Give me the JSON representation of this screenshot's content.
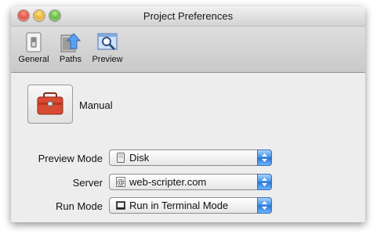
{
  "window": {
    "title": "Project Preferences"
  },
  "toolbar": {
    "items": [
      {
        "label": "General",
        "icon": "general-switch-icon"
      },
      {
        "label": "Paths",
        "icon": "paths-folder-arrow-icon"
      },
      {
        "label": "Preview",
        "icon": "preview-magnifier-icon"
      }
    ]
  },
  "content": {
    "section_label": "Manual",
    "section_icon": "toolbox-icon",
    "fields": [
      {
        "label": "Preview Mode",
        "value": "Disk",
        "icon": "disk-icon"
      },
      {
        "label": "Server",
        "value": "web-scripter.com",
        "icon": "at-sign-icon"
      },
      {
        "label": "Run Mode",
        "value": "Run in Terminal Mode",
        "icon": "terminal-icon"
      }
    ]
  },
  "colors": {
    "popup_arrow_accent": "#3b8ce7",
    "close": "#d22a1c",
    "minimize": "#d89a10",
    "zoom": "#3c9a1c"
  }
}
